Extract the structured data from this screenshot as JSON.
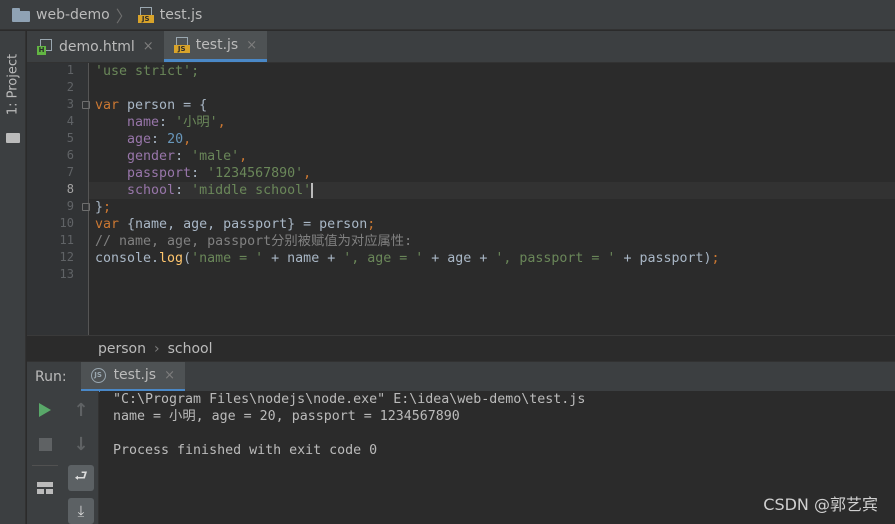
{
  "navbar": {
    "project": "web-demo",
    "separator": "〉",
    "file": "test.js"
  },
  "left_stripe": {
    "project_label": "1: Project"
  },
  "editor_tabs": [
    {
      "label": "demo.html",
      "icon": "html-file-icon",
      "badge": "H",
      "active": false
    },
    {
      "label": "test.js",
      "icon": "js-file-icon",
      "badge": "JS",
      "active": true
    }
  ],
  "close_glyph": "×",
  "editor": {
    "line_numbers": [
      "1",
      "2",
      "3",
      "4",
      "5",
      "6",
      "7",
      "8",
      "9",
      "10",
      "11",
      "12",
      "13"
    ],
    "current_line": 8,
    "colors": {
      "keyword": "#cc7832",
      "string": "#6a8759",
      "number": "#6897bb",
      "property": "#9876aa",
      "plain": "#a9b7c6",
      "function": "#ffc66d",
      "comment": "#808080"
    },
    "lines": [
      [
        {
          "t": "'use strict';",
          "c": "str"
        }
      ],
      [],
      [
        {
          "t": "var",
          "c": "kw"
        },
        {
          "t": " person = {",
          "c": "plain"
        }
      ],
      [
        {
          "t": "    name",
          "c": "prop"
        },
        {
          "t": ": ",
          "c": "plain"
        },
        {
          "t": "'小明'",
          "c": "str"
        },
        {
          "t": ",",
          "c": "kw"
        }
      ],
      [
        {
          "t": "    age",
          "c": "prop"
        },
        {
          "t": ": ",
          "c": "plain"
        },
        {
          "t": "20",
          "c": "num"
        },
        {
          "t": ",",
          "c": "kw"
        }
      ],
      [
        {
          "t": "    gender",
          "c": "prop"
        },
        {
          "t": ": ",
          "c": "plain"
        },
        {
          "t": "'male'",
          "c": "str"
        },
        {
          "t": ",",
          "c": "kw"
        }
      ],
      [
        {
          "t": "    passport",
          "c": "prop"
        },
        {
          "t": ": ",
          "c": "plain"
        },
        {
          "t": "'1234567890'",
          "c": "str"
        },
        {
          "t": ",",
          "c": "kw"
        }
      ],
      [
        {
          "t": "    school",
          "c": "prop"
        },
        {
          "t": ": ",
          "c": "plain"
        },
        {
          "t": "'middle school'",
          "c": "str"
        }
      ],
      [
        {
          "t": "}",
          "c": "plain"
        },
        {
          "t": ";",
          "c": "kw"
        }
      ],
      [
        {
          "t": "var",
          "c": "kw"
        },
        {
          "t": " {name, age, passport} = person",
          "c": "plain"
        },
        {
          "t": ";",
          "c": "kw"
        }
      ],
      [
        {
          "t": "// name, age, passport分别被赋值为对应属性:",
          "c": "cmt"
        }
      ],
      [
        {
          "t": "console.",
          "c": "plain"
        },
        {
          "t": "log",
          "c": "fn"
        },
        {
          "t": "(",
          "c": "plain"
        },
        {
          "t": "'name = '",
          "c": "str"
        },
        {
          "t": " + name + ",
          "c": "plain"
        },
        {
          "t": "', age = '",
          "c": "str"
        },
        {
          "t": " + age + ",
          "c": "plain"
        },
        {
          "t": "', passport = '",
          "c": "str"
        },
        {
          "t": " + passport)",
          "c": "plain"
        },
        {
          "t": ";",
          "c": "kw"
        }
      ],
      []
    ]
  },
  "structure": {
    "items": [
      "person",
      "school"
    ],
    "separator": "›"
  },
  "run": {
    "label": "Run:",
    "tab": "test.js",
    "tab_badge": "JS",
    "console_lines": [
      "\"C:\\Program Files\\nodejs\\node.exe\" E:\\idea\\web-demo\\test.js",
      "name = 小明, age = 20, passport = 1234567890",
      "",
      "Process finished with exit code 0"
    ]
  },
  "toolbar_icons": [
    "run-icon",
    "stop-icon",
    "layout-icon",
    "up-icon",
    "down-icon",
    "soft-wrap-icon",
    "scroll-to-end-icon"
  ],
  "watermark": "CSDN @郭艺宾"
}
